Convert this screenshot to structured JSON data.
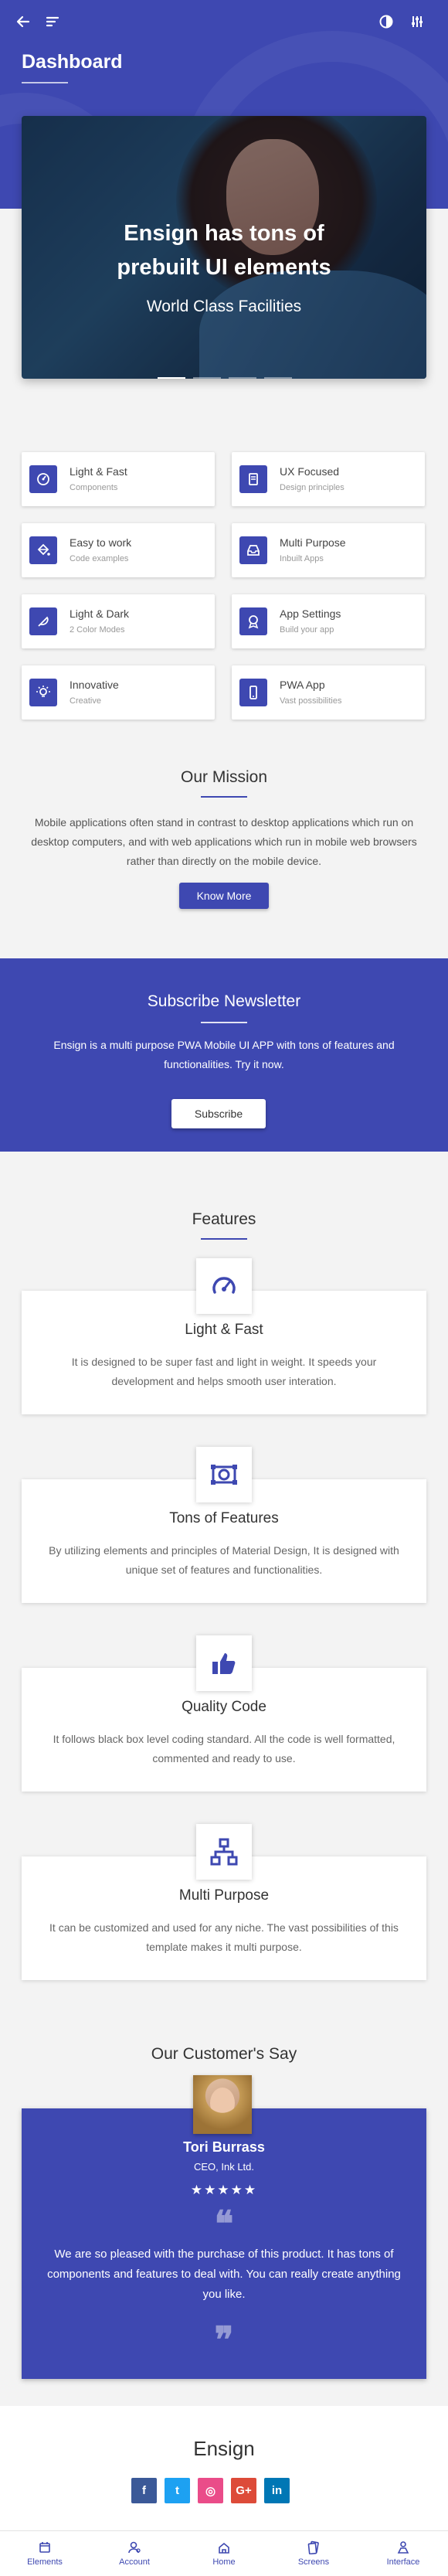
{
  "header": {
    "title": "Dashboard",
    "back_icon": "arrow-left-icon",
    "menu_icon": "menu-lines-icon",
    "theme_icon": "contrast-icon",
    "settings_icon": "sliders-icon",
    "color": "#3e48b1"
  },
  "hero": {
    "title_line1": "Ensign has tons of",
    "title_line2": "prebuilt UI elements",
    "subtitle": "World Class Facilities",
    "slide_count": 4,
    "active_slide": 1
  },
  "feature_grid": [
    {
      "title": "Light & Fast",
      "subtitle": "Components",
      "icon": "speed-icon"
    },
    {
      "title": "UX Focused",
      "subtitle": "Design principles",
      "icon": "book-icon"
    },
    {
      "title": "Easy to work",
      "subtitle": "Code examples",
      "icon": "paint-bucket-icon"
    },
    {
      "title": "Multi Purpose",
      "subtitle": "Inbuilt Apps",
      "icon": "inbox-icon"
    },
    {
      "title": "Light & Dark",
      "subtitle": "2 Color Modes",
      "icon": "feather-icon"
    },
    {
      "title": "App Settings",
      "subtitle": "Build your app",
      "icon": "award-icon"
    },
    {
      "title": "Innovative",
      "subtitle": "Creative",
      "icon": "bulb-icon"
    },
    {
      "title": "PWA App",
      "subtitle": "Vast possibilities",
      "icon": "phone-icon"
    }
  ],
  "mission": {
    "title": "Our Mission",
    "text": "Mobile applications often stand in contrast to desktop applications which run on desktop computers, and with web applications which run in mobile web browsers rather than directly on the mobile device.",
    "button": "Know More"
  },
  "newsletter": {
    "title": "Subscribe Newsletter",
    "text": "Ensign is a multi purpose PWA Mobile UI APP with tons of features and functionalities. Try it now.",
    "button": "Subscribe"
  },
  "features": {
    "title": "Features",
    "items": [
      {
        "title": "Light & Fast",
        "text": "It is designed to be super fast and light in weight. It speeds your development and helps smooth user interation.",
        "icon": "speedometer-icon"
      },
      {
        "title": "Tons of Features",
        "text": "By utilizing elements and principles of Material Design, It is designed with unique set of features and functionalities.",
        "icon": "projector-icon"
      },
      {
        "title": "Quality Code",
        "text": "It follows black box level coding standard. All the code is well formatted, commented and ready to use.",
        "icon": "thumbs-up-icon"
      },
      {
        "title": "Multi Purpose",
        "text": "It can be customized and used for any niche. The vast possibilities of this template makes it multi purpose.",
        "icon": "sitemap-icon"
      }
    ]
  },
  "testimonial": {
    "title": "Our Customer's Say",
    "name": "Tori Burrass",
    "role": "CEO, Ink Ltd.",
    "stars": "★★★★★",
    "rating": 5,
    "open_quote": "❝",
    "close_quote": "❞",
    "text": "We are so pleased with the purchase of this product. It has tons of components and features to deal with. You can really create anything you like."
  },
  "footer": {
    "title": "Ensign",
    "socials": [
      {
        "name": "facebook-icon",
        "glyph": "f",
        "color": "#3b5998"
      },
      {
        "name": "twitter-icon",
        "glyph": "t",
        "color": "#1da1f2"
      },
      {
        "name": "dribbble-icon",
        "glyph": "◎",
        "color": "#ea4c89"
      },
      {
        "name": "google-plus-icon",
        "glyph": "G+",
        "color": "#dd4b39"
      },
      {
        "name": "linkedin-icon",
        "glyph": "in",
        "color": "#0077b5"
      }
    ]
  },
  "bottom_nav": [
    {
      "label": "Elements",
      "icon": "calendar-icon"
    },
    {
      "label": "Account",
      "icon": "account-icon"
    },
    {
      "label": "Home",
      "icon": "home-icon"
    },
    {
      "label": "Screens",
      "icon": "screens-icon"
    },
    {
      "label": "Interface",
      "icon": "interface-icon"
    }
  ]
}
